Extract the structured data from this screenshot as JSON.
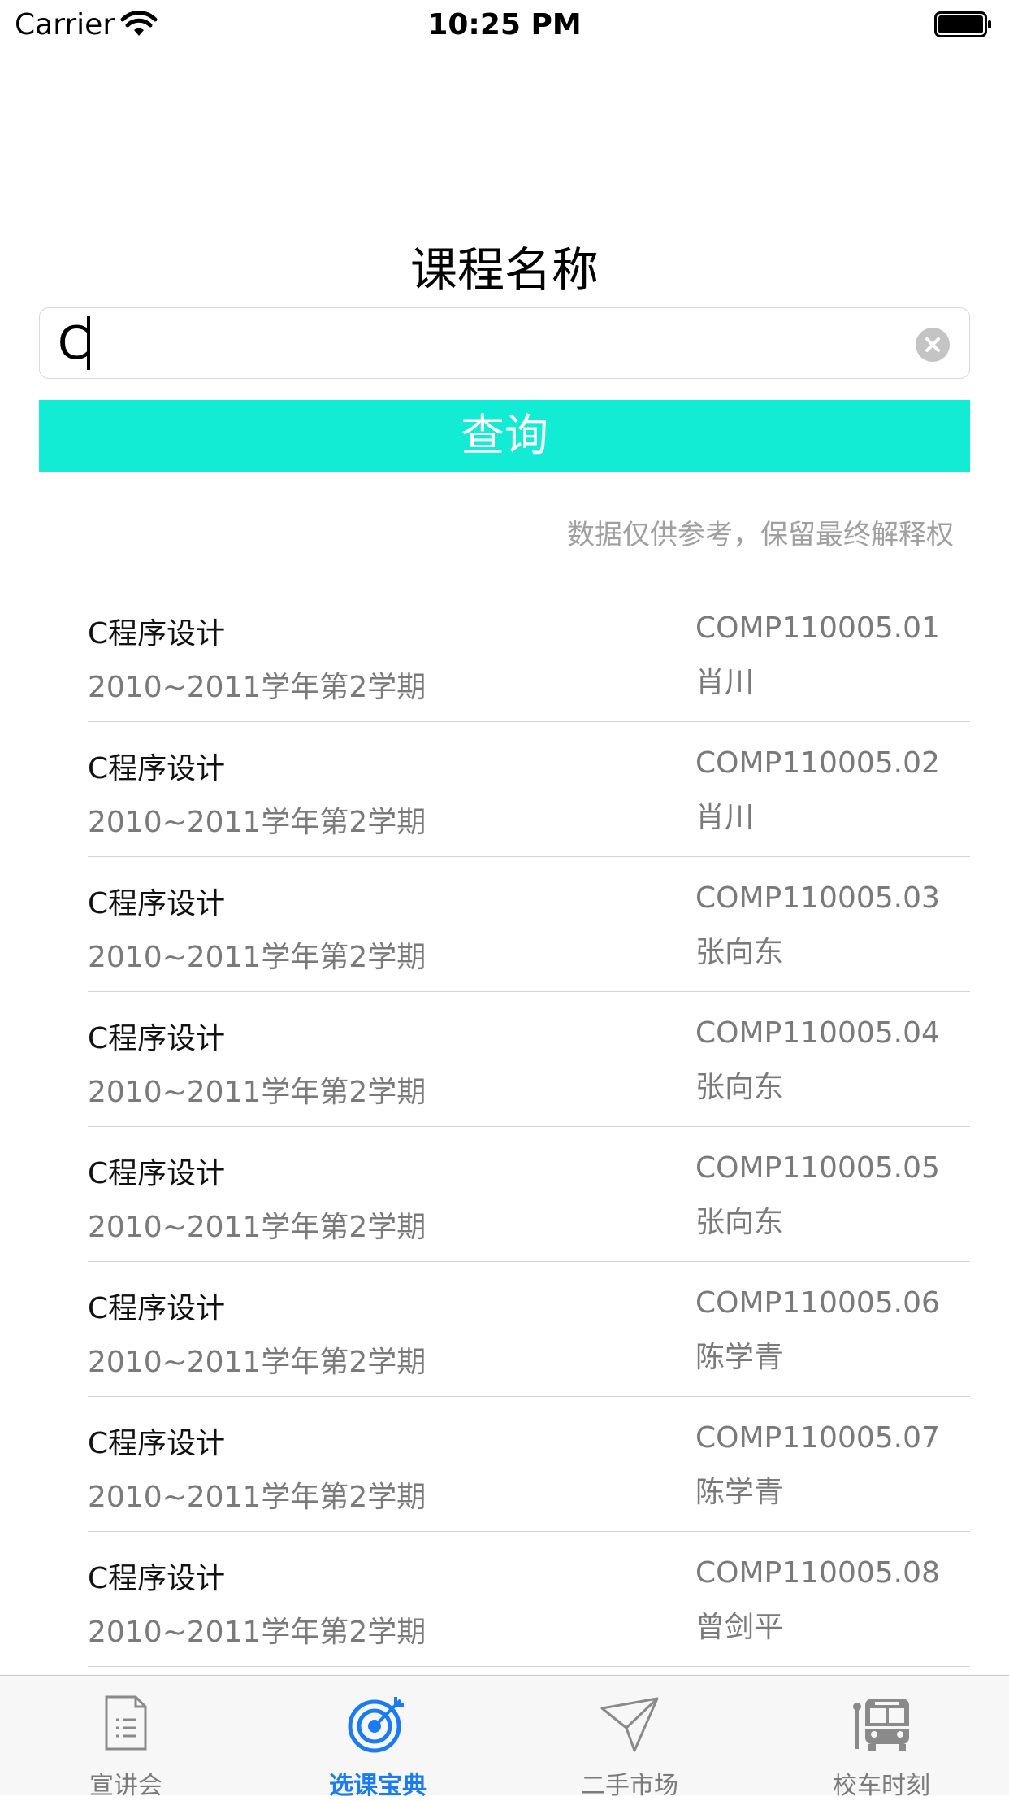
{
  "status_bar": {
    "carrier": "Carrier",
    "time": "10:25 PM"
  },
  "page": {
    "title": "课程名称"
  },
  "search": {
    "value": "C"
  },
  "query_button": {
    "label": "查询"
  },
  "disclaimer": "数据仅供参考，保留最终解释权",
  "courses": [
    {
      "name": "C程序设计",
      "semester": "2010~2011学年第2学期",
      "code": "COMP110005.01",
      "teacher": "肖川"
    },
    {
      "name": "C程序设计",
      "semester": "2010~2011学年第2学期",
      "code": "COMP110005.02",
      "teacher": "肖川"
    },
    {
      "name": "C程序设计",
      "semester": "2010~2011学年第2学期",
      "code": "COMP110005.03",
      "teacher": "张向东"
    },
    {
      "name": "C程序设计",
      "semester": "2010~2011学年第2学期",
      "code": "COMP110005.04",
      "teacher": "张向东"
    },
    {
      "name": "C程序设计",
      "semester": "2010~2011学年第2学期",
      "code": "COMP110005.05",
      "teacher": "张向东"
    },
    {
      "name": "C程序设计",
      "semester": "2010~2011学年第2学期",
      "code": "COMP110005.06",
      "teacher": "陈学青"
    },
    {
      "name": "C程序设计",
      "semester": "2010~2011学年第2学期",
      "code": "COMP110005.07",
      "teacher": "陈学青"
    },
    {
      "name": "C程序设计",
      "semester": "2010~2011学年第2学期",
      "code": "COMP110005.08",
      "teacher": "曾剑平"
    }
  ],
  "tabs": [
    {
      "label": "宣讲会",
      "icon": "document-icon",
      "active": false
    },
    {
      "label": "选课宝典",
      "icon": "target-icon",
      "active": true
    },
    {
      "label": "二手市场",
      "icon": "paper-plane-icon",
      "active": false
    },
    {
      "label": "校车时刻",
      "icon": "bus-icon",
      "active": false
    }
  ],
  "colors": {
    "accent": "#13ecd4",
    "tab_active": "#1a7cf2",
    "tab_inactive": "#7a7a7a"
  }
}
